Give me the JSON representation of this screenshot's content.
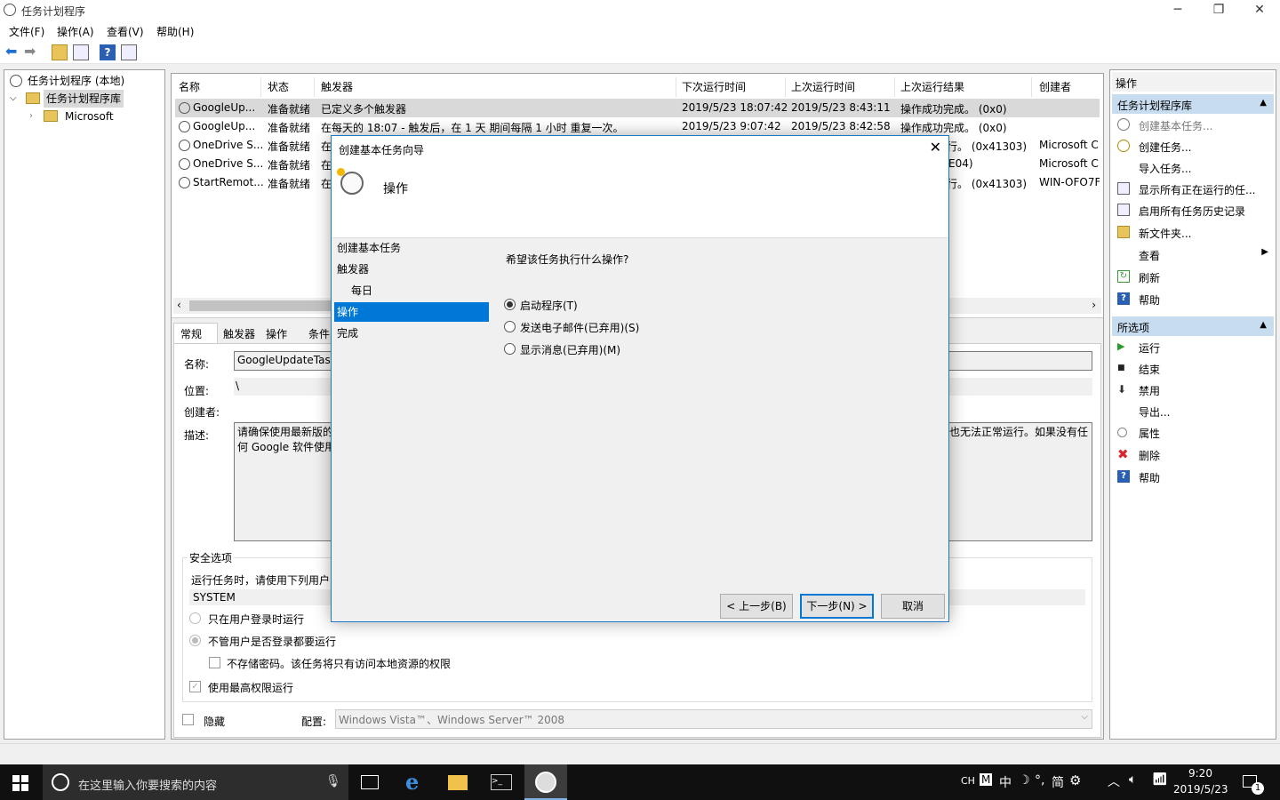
{
  "window": {
    "title": "任务计划程序"
  },
  "menu": [
    "文件(F)",
    "操作(A)",
    "查看(V)",
    "帮助(H)"
  ],
  "tree": {
    "root": "任务计划程序 (本地)",
    "library": "任务计划程序库",
    "child": "Microsoft"
  },
  "table": {
    "columns": [
      "名称",
      "状态",
      "触发器",
      "下次运行时间",
      "上次运行时间",
      "上次运行结果",
      "创建者"
    ],
    "rows": [
      [
        "GoogleUp...",
        "准备就绪",
        "已定义多个触发器",
        "2019/5/23 18:07:42",
        "2019/5/23 8:43:11",
        "操作成功完成。 (0x0)",
        ""
      ],
      [
        "GoogleUp...",
        "准备就绪",
        "在每天的 18:07 - 触发后，在 1 天 期间每隔 1 小时 重复一次。",
        "2019/5/23 9:07:42",
        "2019/5/23 8:42:58",
        "操作成功完成。 (0x0)",
        ""
      ],
      [
        "OneDrive S...",
        "准备就绪",
        "在",
        "",
        "",
        "行。 (0x41303)",
        "Microsoft C"
      ],
      [
        "OneDrive S...",
        "准备就绪",
        "在",
        "",
        "",
        "E04)",
        "Microsoft C"
      ],
      [
        "StartRemot...",
        "准备就绪",
        "在",
        "",
        "",
        "行。 (0x41303)",
        "WIN-OFO7F"
      ]
    ]
  },
  "detail": {
    "tabs": [
      "常规",
      "触发器",
      "操作",
      "条件"
    ],
    "name_label": "名称:",
    "name_value": "GoogleUpdateTas",
    "location_label": "位置:",
    "location_value": "\\",
    "author_label": "创建者:",
    "desc_label": "描述:",
    "desc_line1": "请确保使用最新版的",
    "desc_line2": "何 Google 软件使用",
    "desc_right": "也无法正常运行。如果没有任",
    "security_title": "安全选项",
    "security_text": "运行任务时，请使用下列用户",
    "user_value": "SYSTEM",
    "opt_logged_on": "只在用户登录时运行",
    "opt_whether": "不管用户是否登录都要运行",
    "opt_no_password": "不存储密码。该任务将只有访问本地资源的权限",
    "opt_highest": "使用最高权限运行",
    "hidden_label": "隐藏",
    "config_label": "配置:",
    "config_value": "Windows Vista™、Windows Server™ 2008"
  },
  "actions_pane": {
    "title": "操作",
    "section1": "任务计划程序库",
    "items1": [
      "创建基本任务...",
      "创建任务...",
      "导入任务...",
      "显示所有正在运行的任...",
      "启用所有任务历史记录",
      "新文件夹...",
      "查看",
      "刷新",
      "帮助"
    ],
    "section2": "所选项",
    "items2": [
      "运行",
      "结束",
      "禁用",
      "导出...",
      "属性",
      "删除",
      "帮助"
    ]
  },
  "dialog": {
    "title": "创建基本任务向导",
    "header": "操作",
    "steps": [
      "创建基本任务",
      "触发器",
      "每日",
      "操作",
      "完成"
    ],
    "question": "希望该任务执行什么操作?",
    "options": [
      "启动程序(T)",
      "发送电子邮件(已弃用)(S)",
      "显示消息(已弃用)(M)"
    ],
    "selected_option": 0,
    "back_button": "< 上一步(B)",
    "next_button": "下一步(N) >",
    "cancel_button": "取消"
  },
  "taskbar": {
    "search_placeholder": "在这里输入你要搜索的内容",
    "ime": [
      "CH",
      "M",
      "中",
      "简"
    ],
    "time": "9:20",
    "date": "2019/5/23",
    "notifications": "1"
  },
  "colors": {
    "accent": "#0078d7",
    "selection": "#cce8ff",
    "step_selected": "#0078d7",
    "section_header": "#c8dcf0"
  }
}
